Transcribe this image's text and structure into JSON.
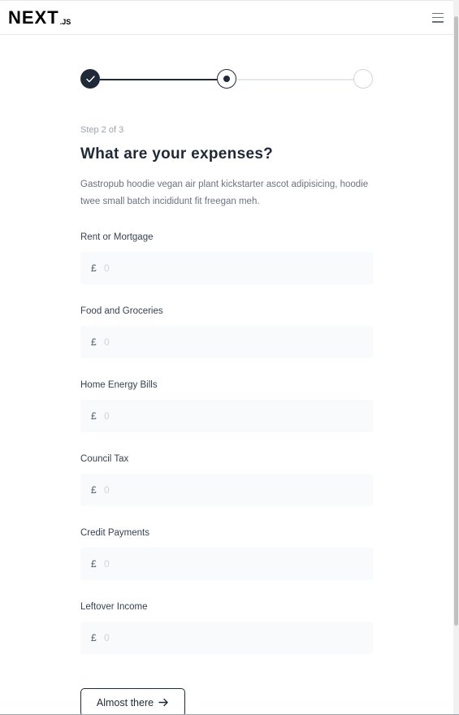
{
  "header": {
    "logo_main": "NEXT",
    "logo_sub": ".JS"
  },
  "stepper": {
    "step_label": "Step 2 of 3",
    "current": 2,
    "total": 3
  },
  "main": {
    "title": "What are your expenses?",
    "description": "Gastropub hoodie vegan air plant kickstarter ascot adipisicing, hoodie twee small batch incididunt fit freegan meh."
  },
  "fields": [
    {
      "label": "Rent or Mortgage",
      "currency": "£",
      "placeholder": "0"
    },
    {
      "label": "Food and Groceries",
      "currency": "£",
      "placeholder": "0"
    },
    {
      "label": "Home Energy Bills",
      "currency": "£",
      "placeholder": "0"
    },
    {
      "label": "Council Tax",
      "currency": "£",
      "placeholder": "0"
    },
    {
      "label": "Credit Payments",
      "currency": "£",
      "placeholder": "0"
    },
    {
      "label": "Leftover Income",
      "currency": "£",
      "placeholder": "0"
    }
  ],
  "submit": {
    "label": "Almost there"
  },
  "icons": {
    "menu": "hamburger-menu-icon",
    "check": "check-icon",
    "arrow": "arrow-right-icon"
  },
  "colors": {
    "primary": "#1f2937",
    "input_bg": "#f9fafb",
    "muted": "#9ca3af"
  }
}
